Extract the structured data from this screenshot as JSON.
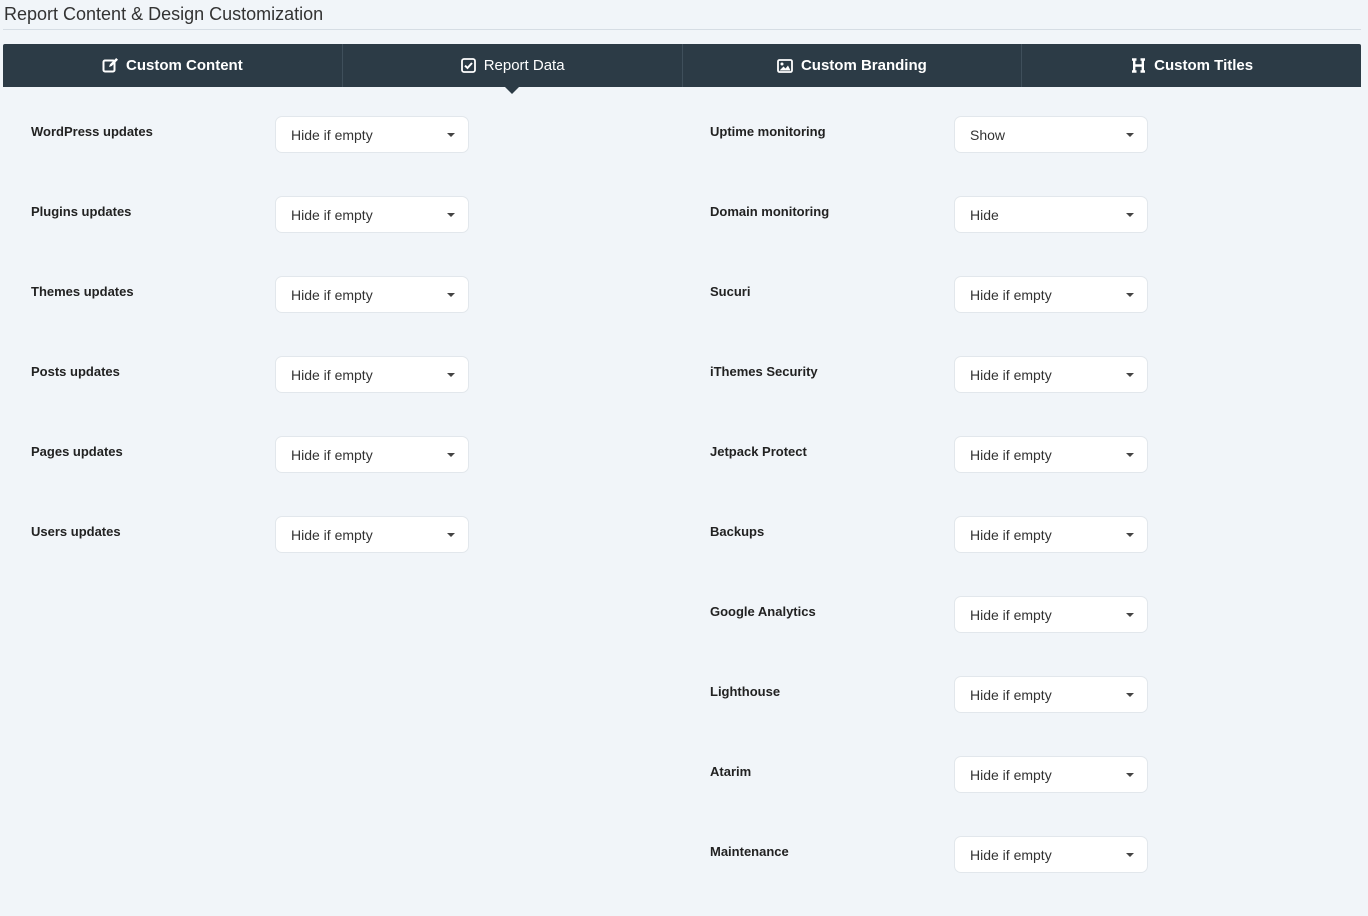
{
  "page": {
    "title": "Report Content & Design Customization"
  },
  "tabs": [
    {
      "label": "Custom Content",
      "icon": "edit-icon",
      "active": false
    },
    {
      "label": "Report Data",
      "icon": "checkbox-icon",
      "active": true
    },
    {
      "label": "Custom Branding",
      "icon": "image-icon",
      "active": false
    },
    {
      "label": "Custom Titles",
      "icon": "heading-icon",
      "active": false
    }
  ],
  "left_settings": [
    {
      "label": "WordPress updates",
      "value": "Hide if empty"
    },
    {
      "label": "Plugins updates",
      "value": "Hide if empty"
    },
    {
      "label": "Themes updates",
      "value": "Hide if empty"
    },
    {
      "label": "Posts updates",
      "value": "Hide if empty"
    },
    {
      "label": "Pages updates",
      "value": "Hide if empty"
    },
    {
      "label": "Users updates",
      "value": "Hide if empty"
    }
  ],
  "right_settings": [
    {
      "label": "Uptime monitoring",
      "value": "Show"
    },
    {
      "label": "Domain monitoring",
      "value": "Hide"
    },
    {
      "label": "Sucuri",
      "value": "Hide if empty"
    },
    {
      "label": "iThemes Security",
      "value": "Hide if empty"
    },
    {
      "label": "Jetpack Protect",
      "value": "Hide if empty"
    },
    {
      "label": "Backups",
      "value": "Hide if empty"
    },
    {
      "label": "Google Analytics",
      "value": "Hide if empty"
    },
    {
      "label": "Lighthouse",
      "value": "Hide if empty"
    },
    {
      "label": "Atarim",
      "value": "Hide if empty"
    },
    {
      "label": "Maintenance",
      "value": "Hide if empty"
    }
  ],
  "colors": {
    "tabbar_bg": "#2c3b46",
    "page_bg": "#f1f5f9",
    "select_bg": "#ffffff"
  }
}
